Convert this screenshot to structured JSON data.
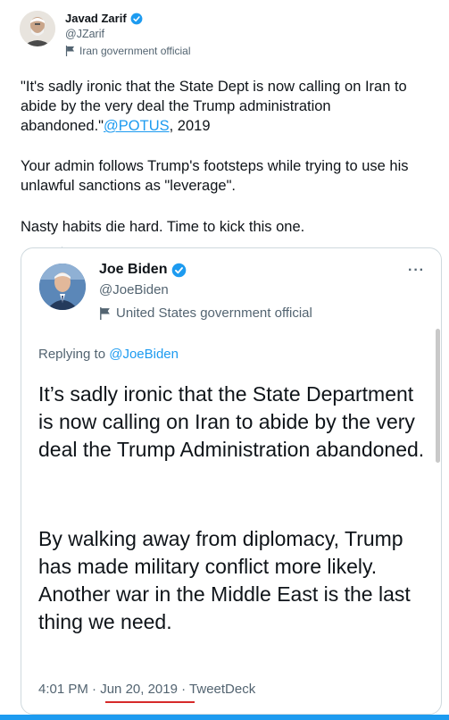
{
  "tweet": {
    "author": {
      "display_name": "Javad Zarif",
      "handle": "@JZarif",
      "label": "Iran government official",
      "verified": true,
      "avatar_icon": "portrait-avatar"
    },
    "text": {
      "p1_before": "\"It's sadly ironic that the State Dept is now calling on Iran to abide by the very deal the Trump administration abandoned.\"",
      "p1_mention": "@POTUS",
      "p1_after": ", 2019",
      "p2": "Your admin follows Trump's footsteps while trying to use his unlawful sanctions as \"leverage\".",
      "p3": "Nasty habits die hard. Time to kick this one."
    }
  },
  "quoted": {
    "author": {
      "display_name": "Joe Biden",
      "handle": "@JoeBiden",
      "label": "United States government official",
      "verified": true
    },
    "more_icon": "more-dots-icon",
    "replying_prefix": "Replying to ",
    "replying_mention": "@JoeBiden",
    "p1": "It’s sadly ironic that the State Department is now calling on Iran to abide by the very deal the Trump Administration abandoned.",
    "p2": "By walking away from diplomacy, Trump has made military conflict more likely. Another war in the Middle East is the last thing we need.",
    "time": "4:01 PM",
    "date": "Jun 20, 2019",
    "source": "TweetDeck",
    "separator": " · "
  },
  "colors": {
    "accent": "#1d9bf0",
    "text": "#0f1419",
    "muted": "#536471",
    "underline": "#d62a2a"
  }
}
